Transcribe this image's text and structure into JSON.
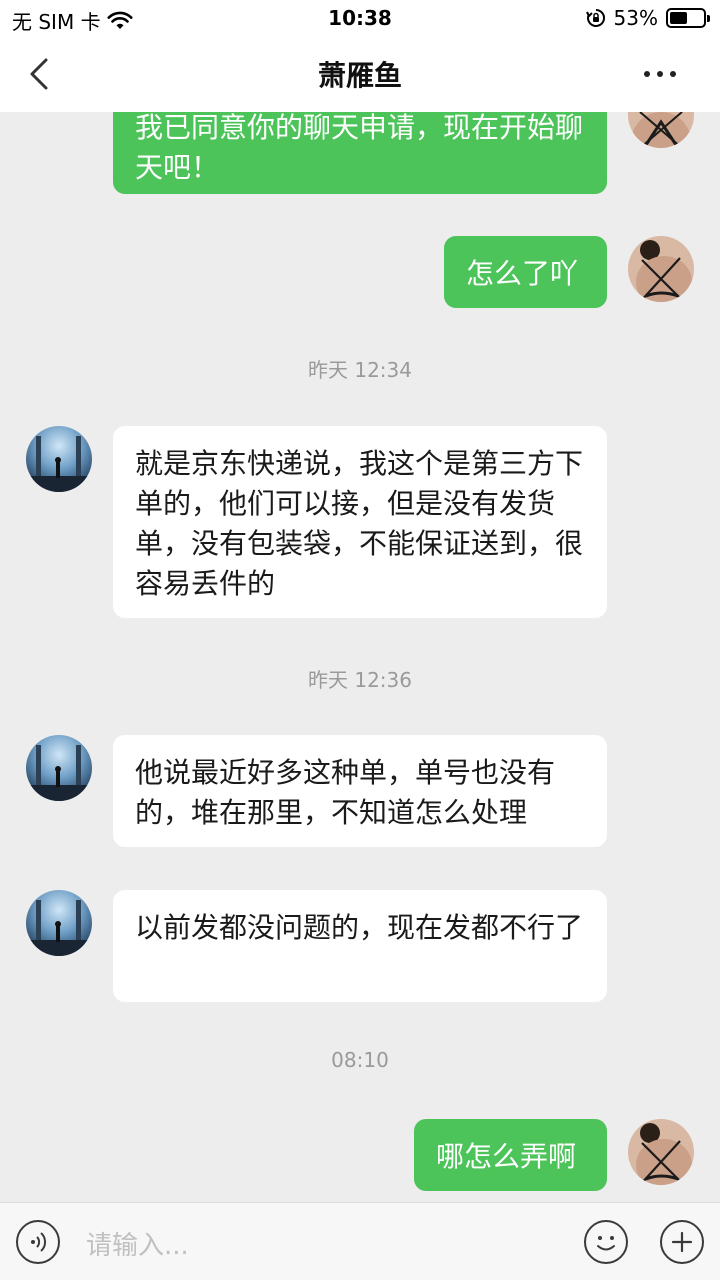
{
  "status_bar": {
    "carrier": "无 SIM 卡",
    "time": "10:38",
    "battery": "53%",
    "battery_level": 0.53
  },
  "header": {
    "title": "萧雁鱼",
    "back_icon": "chevron-left-icon",
    "more_icon": "more-dots-icon"
  },
  "messages": [
    {
      "from": "self",
      "text": "我已同意你的聊天申请，现在开始聊天吧！"
    },
    {
      "from": "self",
      "text": "怎么了吖"
    },
    {
      "type": "time",
      "text": "昨天 12:34"
    },
    {
      "from": "other",
      "text": "就是京东快递说，我这个是第三方下单的，他们可以接，但是没有发货单，没有包装袋，不能保证送到，很容易丢件的"
    },
    {
      "type": "time",
      "text": "昨天 12:36"
    },
    {
      "from": "other",
      "text": "他说最近好多这种单，单号也没有的，堆在那里，不知道怎么处理"
    },
    {
      "from": "other",
      "text": "以前发都没问题的，现在发都不行了"
    },
    {
      "type": "time",
      "text": "08:10"
    },
    {
      "from": "self",
      "text": "哪怎么弄啊"
    }
  ],
  "input": {
    "placeholder": "请输入...",
    "voice_icon": "voice-icon",
    "emoji_icon": "emoji-icon",
    "add_icon": "plus-icon"
  },
  "colors": {
    "self_bubble": "#4cc45a",
    "other_bubble": "#ffffff",
    "background": "#ededed"
  }
}
